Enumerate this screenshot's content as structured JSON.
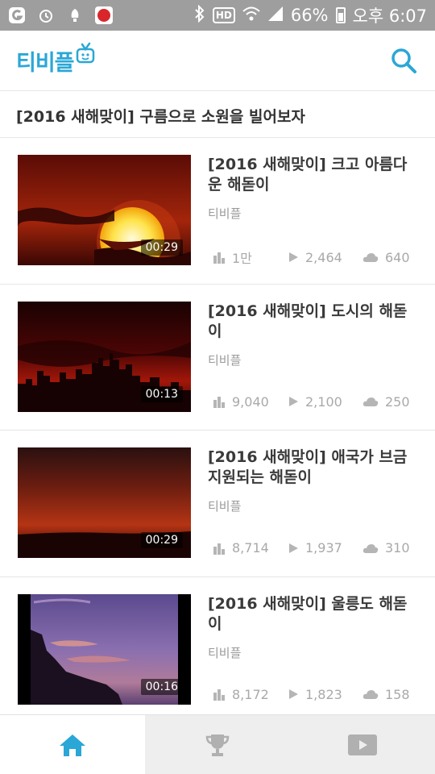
{
  "status_bar": {
    "battery": "66%",
    "time": "오후 6:07",
    "hd": "HD"
  },
  "header": {
    "logo_text": "티비플",
    "search_icon": "search-icon",
    "brand_color": "#2aa7d6"
  },
  "playlist": {
    "title": "[2016 새해맞이] 구름으로 소원을 빌어보자"
  },
  "videos": [
    {
      "title": "[2016 새해맞이] 크고 아름다운 해돋이",
      "channel": "티비플",
      "duration": "00:29",
      "views": "1만",
      "plays": "2,464",
      "clouds": "640"
    },
    {
      "title": "[2016 새해맞이] 도시의 해돋이",
      "channel": "티비플",
      "duration": "00:13",
      "views": "9,040",
      "plays": "2,100",
      "clouds": "250"
    },
    {
      "title": "[2016 새해맞이] 애국가 브금 지원되는 해돋이",
      "channel": "티비플",
      "duration": "00:29",
      "views": "8,714",
      "plays": "1,937",
      "clouds": "310"
    },
    {
      "title": "[2016 새해맞이] 울릉도 해돋이",
      "channel": "티비플",
      "duration": "00:16",
      "views": "8,172",
      "plays": "1,823",
      "clouds": "158"
    }
  ],
  "bottom_nav": {
    "tabs": [
      "home-icon",
      "trophy-icon",
      "video-play-icon"
    ],
    "active_color": "#2aa7d6"
  }
}
